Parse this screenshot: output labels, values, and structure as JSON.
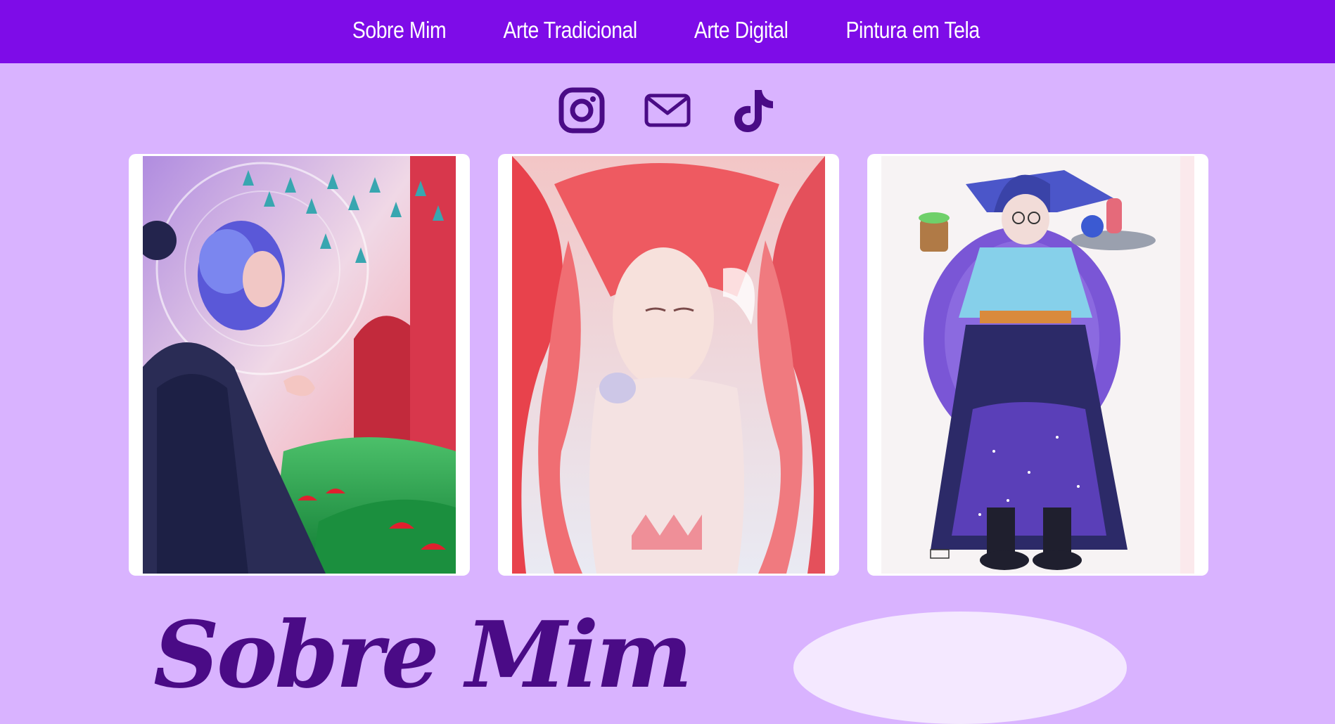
{
  "nav": {
    "items": [
      {
        "label": "Sobre Mim"
      },
      {
        "label": "Arte Tradicional"
      },
      {
        "label": "Arte Digital"
      },
      {
        "label": "Pintura em Tela"
      }
    ]
  },
  "social": {
    "icons": [
      "instagram-icon",
      "mail-icon",
      "tiktok-icon"
    ]
  },
  "gallery": {
    "images": [
      {
        "subject": "witch-with-blue-hair-and-mushrooms"
      },
      {
        "subject": "pink-mermaid-with-jellyfish"
      },
      {
        "subject": "wizard-with-mug-and-potions"
      }
    ]
  },
  "about": {
    "title": "Sobre Mim"
  },
  "colors": {
    "nav_background": "#7e0ce8",
    "page_background": "#d9b3ff",
    "icon_color": "#4a0b86",
    "title_color": "#4a0b86",
    "card_background": "#ffffff"
  }
}
